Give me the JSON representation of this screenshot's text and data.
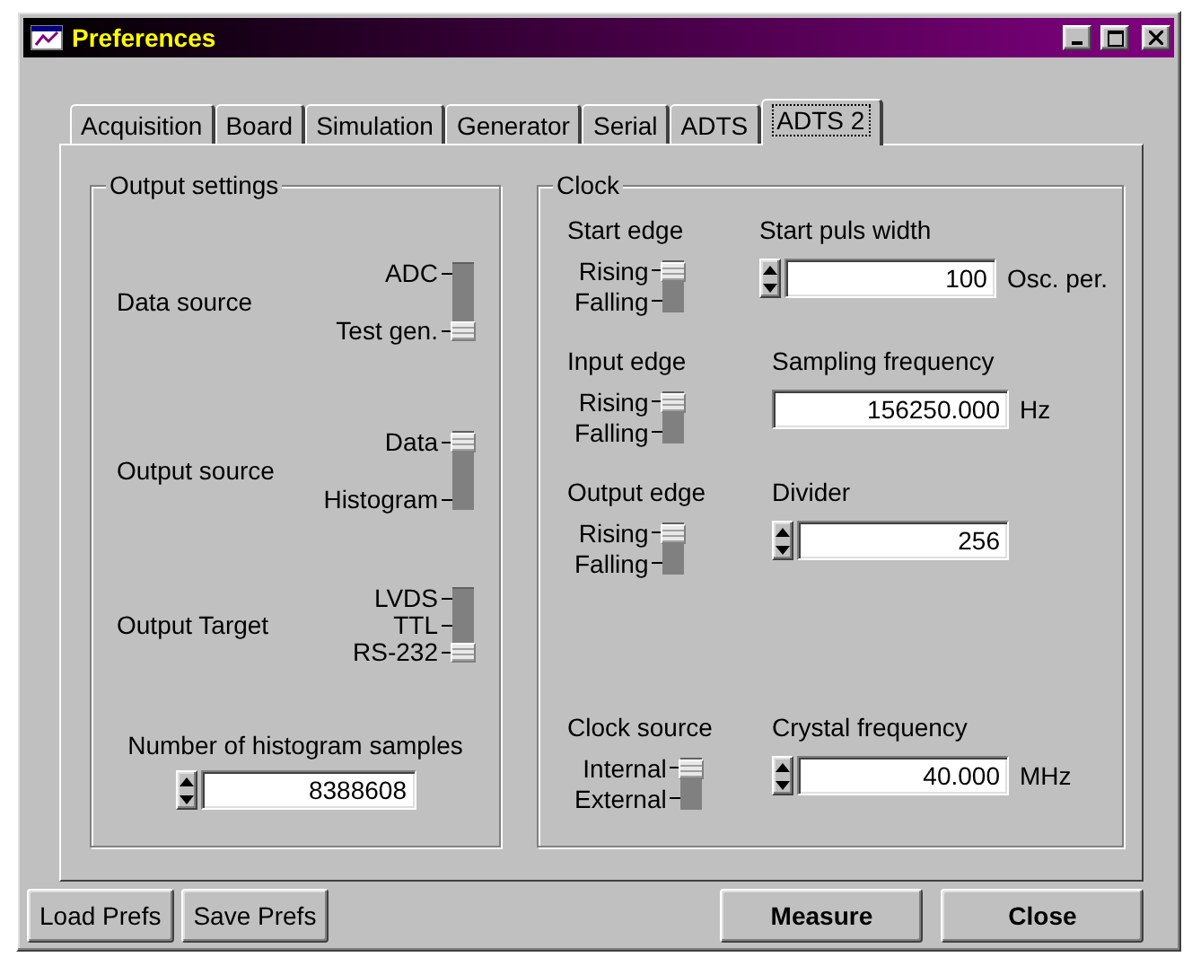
{
  "window": {
    "title": "Preferences"
  },
  "tabs": [
    {
      "label": "Acquisition",
      "selected": false
    },
    {
      "label": "Board",
      "selected": false
    },
    {
      "label": "Simulation",
      "selected": false
    },
    {
      "label": "Generator",
      "selected": false
    },
    {
      "label": "Serial",
      "selected": false
    },
    {
      "label": "ADTS",
      "selected": false
    },
    {
      "label": "ADTS 2",
      "selected": true
    }
  ],
  "output_settings": {
    "title": "Output settings",
    "switches": [
      {
        "label": "Data source",
        "options": [
          {
            "label": "ADC",
            "selected": false
          },
          {
            "label": "Test gen.",
            "selected": true
          }
        ]
      },
      {
        "label": "Output source",
        "options": [
          {
            "label": "Data",
            "selected": true
          },
          {
            "label": "Histogram",
            "selected": false
          }
        ]
      },
      {
        "label": "Output Target",
        "options": [
          {
            "label": "LVDS",
            "selected": false
          },
          {
            "label": "TTL",
            "selected": false
          },
          {
            "label": "RS-232",
            "selected": true
          }
        ]
      }
    ],
    "histogram_samples": {
      "label": "Number of histogram samples",
      "value": "8388608",
      "spinner": true
    }
  },
  "clock": {
    "title": "Clock",
    "rows": [
      {
        "switch": {
          "label": "Start edge",
          "options": [
            {
              "label": "Rising",
              "selected": true
            },
            {
              "label": "Falling",
              "selected": false
            }
          ]
        },
        "field": {
          "label": "Start puls width",
          "value": "100",
          "unit": "Osc. per.",
          "spinner": true
        }
      },
      {
        "switch": {
          "label": "Input edge",
          "options": [
            {
              "label": "Rising",
              "selected": true
            },
            {
              "label": "Falling",
              "selected": false
            }
          ]
        },
        "field": {
          "label": "Sampling frequency",
          "value": "156250.000",
          "unit": "Hz",
          "spinner": false
        }
      },
      {
        "switch": {
          "label": "Output edge",
          "options": [
            {
              "label": "Rising",
              "selected": true
            },
            {
              "label": "Falling",
              "selected": false
            }
          ]
        },
        "field": {
          "label": "Divider",
          "value": "256",
          "spinner": true
        }
      },
      {
        "switch": {
          "label": "Clock source",
          "options": [
            {
              "label": "Internal",
              "selected": true
            },
            {
              "label": "External",
              "selected": false
            }
          ]
        },
        "field": {
          "label": "Crystal frequency",
          "value": "40.000",
          "unit": "MHz",
          "spinner": true
        }
      }
    ]
  },
  "buttons": [
    {
      "label": "Load Prefs",
      "kind": "plain"
    },
    {
      "label": "Save Prefs",
      "kind": "plain"
    },
    {
      "label": "Measure",
      "kind": "bold"
    },
    {
      "label": "Close",
      "kind": "bold"
    }
  ]
}
